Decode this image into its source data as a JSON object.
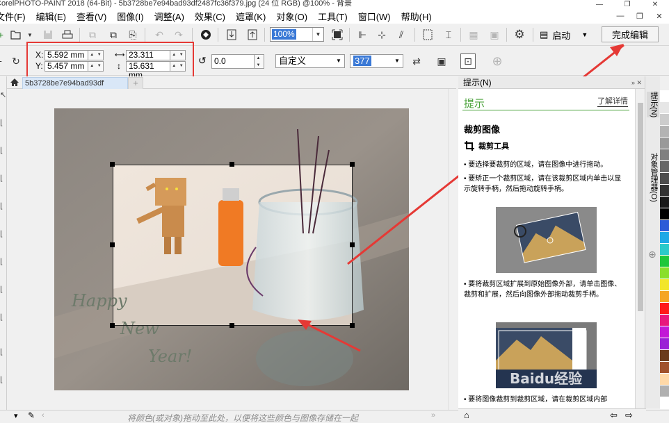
{
  "window": {
    "title": "CorelPHOTO-PAINT 2018 (64-Bit) - 5b3728be7e94bad93df2487fc36f379.jpg (24 位 RGB) @100% - 背景",
    "controls": [
      "—",
      "❐",
      "✕"
    ]
  },
  "menu": {
    "items": [
      "文件(F)",
      "编辑(E)",
      "查看(V)",
      "图像(I)",
      "调整(A)",
      "效果(C)",
      "遮罩(K)",
      "对象(O)",
      "工具(T)",
      "窗口(W)",
      "帮助(H)"
    ],
    "right_controls": [
      "—",
      "❐",
      "✕"
    ]
  },
  "toolbar": {
    "zoom_value": "100%",
    "startup_label": "启动",
    "finish_button": "完成编辑"
  },
  "property_bar": {
    "x_label": "X:",
    "x_value": "5.592 mm",
    "y_label": "Y:",
    "y_value": "5.457 mm",
    "width_value": "23.311 mm",
    "height_value": "15.631 mm",
    "rotation_value": "0.0",
    "preset_value": "自定义",
    "resolution_value": "377"
  },
  "document": {
    "tab_label": "5b3728be7e94bad93df",
    "photo_text": [
      "Happy",
      "New",
      "Year!"
    ]
  },
  "status": {
    "hint": "将颜色(或对象)拖动至此处，以便将这些颜色与图像存储在一起"
  },
  "hints_panel": {
    "header": "提示(N)",
    "title": "提示",
    "learn_more": "了解详情",
    "heading": "裁剪图像",
    "tool_name": "裁剪工具",
    "bullets": [
      "• 要选择要裁剪的区域，请在图像中进行拖动。",
      "• 要矫正一个裁剪区域，请在该裁剪区域内单击以显示旋转手柄，然后拖动旋转手柄。",
      "• 要将裁剪区域扩展到原始图像外部，请单击图像、裁剪和扩展，然后向图像外部拖动裁剪手柄。",
      "• 要将图像裁剪到裁剪区域，请在裁剪区域内部"
    ],
    "watermark": "Baidu经验"
  },
  "side_tabs": [
    "提示(N)",
    "对象管理器(O)"
  ],
  "palette_colors": [
    "#ffffff",
    "#e6e6e6",
    "#cccccc",
    "#b3b3b3",
    "#999999",
    "#808080",
    "#666666",
    "#4d4d4d",
    "#333333",
    "#1a1a1a",
    "#000000",
    "#2d5bd7",
    "#1ea8e6",
    "#2bcaca",
    "#1fc73a",
    "#8adf2b",
    "#f2e62a",
    "#f5a623",
    "#ff1a1a",
    "#e8177d",
    "#c218d6",
    "#9b1fd6",
    "#6a3b1c",
    "#a0522d",
    "#ffd9a8",
    "#b0b0b0",
    "#ffffff"
  ]
}
